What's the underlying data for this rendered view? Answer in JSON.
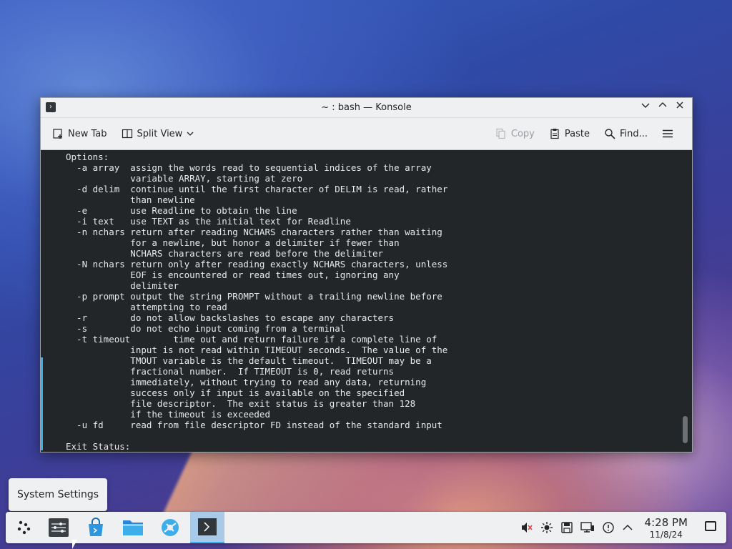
{
  "window": {
    "title": "~ : bash — Konsole",
    "app_icon": "konsole-icon"
  },
  "toolbar": {
    "new_tab": "New Tab",
    "split_view": "Split View",
    "copy": "Copy",
    "paste": "Paste",
    "find": "Find..."
  },
  "terminal": {
    "lines": [
      "Options:",
      "  -a array  assign the words read to sequential indices of the array",
      "            variable ARRAY, starting at zero",
      "  -d delim  continue until the first character of DELIM is read, rather",
      "            than newline",
      "  -e        use Readline to obtain the line",
      "  -i text   use TEXT as the initial text for Readline",
      "  -n nchars return after reading NCHARS characters rather than waiting",
      "            for a newline, but honor a delimiter if fewer than",
      "            NCHARS characters are read before the delimiter",
      "  -N nchars return only after reading exactly NCHARS characters, unless",
      "            EOF is encountered or read times out, ignoring any",
      "            delimiter",
      "  -p prompt output the string PROMPT without a trailing newline before",
      "            attempting to read",
      "  -r        do not allow backslashes to escape any characters",
      "  -s        do not echo input coming from a terminal",
      "  -t timeout        time out and return failure if a complete line of",
      "            input is not read within TIMEOUT seconds.  The value of the",
      "            TMOUT variable is the default timeout.  TIMEOUT may be a",
      "            fractional number.  If TIMEOUT is 0, read returns",
      "            immediately, without trying to read any data, returning",
      "            success only if input is available on the specified",
      "            file descriptor.  The exit status is greater than 128",
      "            if the timeout is exceeded",
      "  -u fd     read from file descriptor FD instead of the standard input",
      "",
      "Exit Status:"
    ]
  },
  "tooltip": {
    "text": "System Settings"
  },
  "taskbar": {
    "apps": [
      {
        "name": "application-launcher",
        "icon": "kde-launcher-icon"
      },
      {
        "name": "system-settings",
        "icon": "settings-icon"
      },
      {
        "name": "discover",
        "icon": "discover-store-icon"
      },
      {
        "name": "dolphin",
        "icon": "folder-icon"
      },
      {
        "name": "browser",
        "icon": "browser-icon"
      },
      {
        "name": "konsole",
        "icon": "terminal-icon",
        "active": true
      }
    ],
    "tray": [
      "volume-muted-icon",
      "brightness-icon",
      "disk-icon",
      "network-icon",
      "updates-icon",
      "chevron-up-icon"
    ],
    "clock_time": "4:28 PM",
    "clock_date": "11/8/24"
  }
}
